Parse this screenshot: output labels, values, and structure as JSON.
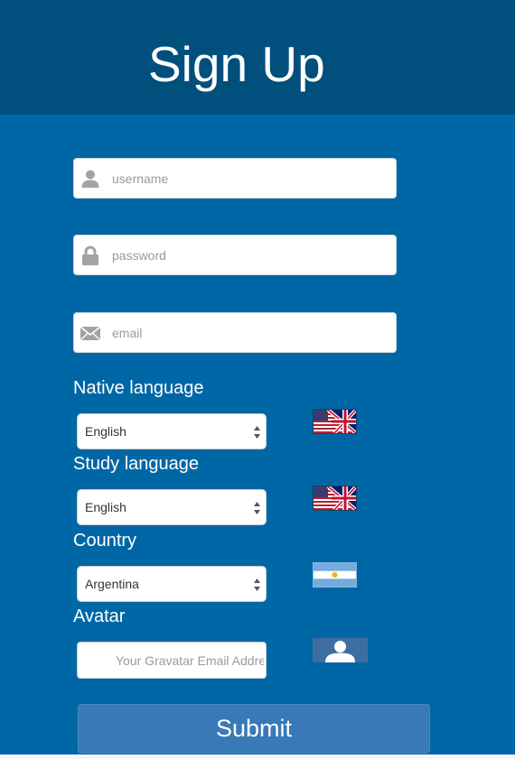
{
  "header": {
    "title": "Sign Up"
  },
  "form": {
    "username": {
      "placeholder": "username",
      "value": "",
      "icon": "user-icon"
    },
    "password": {
      "placeholder": "password",
      "value": "",
      "icon": "lock-icon"
    },
    "email": {
      "placeholder": "email",
      "value": "",
      "icon": "envelope-icon"
    },
    "native_language": {
      "label": "Native language",
      "selected": "English",
      "flag": "us-uk-flag"
    },
    "study_language": {
      "label": "Study language",
      "selected": "English",
      "flag": "us-uk-flag"
    },
    "country": {
      "label": "Country",
      "selected": "Argentina",
      "flag": "argentina-flag"
    },
    "avatar": {
      "label": "Avatar",
      "placeholder": "Your Gravatar Email Address",
      "value": "",
      "icon": "avatar-placeholder-icon"
    },
    "submit_label": "Submit"
  },
  "colors": {
    "page_background": "#0067a6",
    "header_background": "#004f7c",
    "submit_background": "#3979b8",
    "text_light": "#ffffff"
  }
}
